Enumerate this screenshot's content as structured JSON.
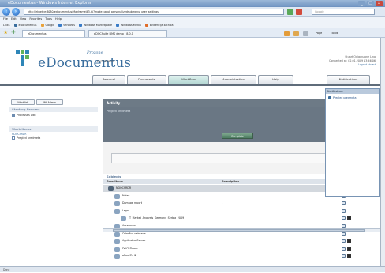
{
  "window": {
    "title": "eDocumentus - Windows Internet Explorer"
  },
  "address_bar": {
    "url": "http://ekoetce:8080/edocumentus/Manhamel43.jsi?mode=appl_personalizedsubmenu_user_settings",
    "search_placeholder": "Google"
  },
  "menu": {
    "items": [
      "File",
      "Edit",
      "View",
      "Favorites",
      "Tools",
      "Help"
    ]
  },
  "favorites": {
    "label": "Links",
    "items": [
      "eDocumentus",
      "Google",
      "Windows",
      "Windows Marketplace",
      "Windows Media",
      "Evidencija zatnica"
    ]
  },
  "browser_tabs": [
    {
      "label": "eDocumentus"
    },
    {
      "label": "eDOCSuite DMS demo - 8.0.1"
    }
  ],
  "browser_tools": {
    "page": "Page",
    "tools": "Tools"
  },
  "header": {
    "brand_prefix": "Prozone",
    "brand": "eDocumentus",
    "edition": "ENTERPRISE",
    "user_line1": "Stuart Odigonzone Lino",
    "user_line2": "Connected at: 02.01.2009 13:46:06",
    "logout": "Logout stuart"
  },
  "main_tabs": [
    {
      "label": "Personal",
      "active": false
    },
    {
      "label": "Documents",
      "active": false
    },
    {
      "label": "Workflow",
      "active": true
    },
    {
      "label": "Administration",
      "active": false
    },
    {
      "label": "Help",
      "active": false
    },
    {
      "label": "Notifications",
      "active": false
    }
  ],
  "sidebar": {
    "tabs": [
      "Worklist",
      "Wf Admin"
    ],
    "starting_process_title": "Starting Process",
    "process_list": "Processes List",
    "work_items_title": "Work Items",
    "work_items_sub": "NDOCSRDR",
    "work_item": "Pregled predmeta"
  },
  "activity": {
    "title": "Activity",
    "label": "Pregled predmeta",
    "complete_button": "Complete"
  },
  "subjects": {
    "title": "Subjects",
    "columns": [
      "Case Name",
      "Description",
      "Options"
    ],
    "rows": [
      {
        "name": "NDOCSRDR",
        "desc": "-",
        "level": 0,
        "highlight": true
      },
      {
        "name": "Notes",
        "desc": "-",
        "level": 1,
        "highlight": false
      },
      {
        "name": "Damage report",
        "desc": "-",
        "level": 1,
        "highlight": false
      },
      {
        "name": "Legal",
        "desc": "-",
        "level": 1,
        "highlight": false
      },
      {
        "name": "IT_Market_Analysis_Germany_Serbia_2009",
        "desc": "",
        "level": 2,
        "highlight": false
      },
      {
        "name": "Assesment",
        "desc": "-",
        "level": 1,
        "highlight": false
      },
      {
        "name": "Odrađun naknada",
        "desc": "-",
        "level": 1,
        "highlight": false
      },
      {
        "name": "ApplicationServer",
        "desc": "-",
        "level": 1,
        "highlight": false
      },
      {
        "name": "DOCRDemo",
        "desc": "-",
        "level": 1,
        "highlight": false
      },
      {
        "name": "eDoc EV IN",
        "desc": "-",
        "level": 1,
        "highlight": false
      }
    ]
  },
  "notifications": {
    "header": "Notifications",
    "item": "Pregled predmeta"
  },
  "statusbar": {
    "text": "Done"
  },
  "colors": {
    "accent": "#3a6e9e",
    "activity_bg": "#6a7784",
    "complete_btn": "#4e7d62"
  }
}
